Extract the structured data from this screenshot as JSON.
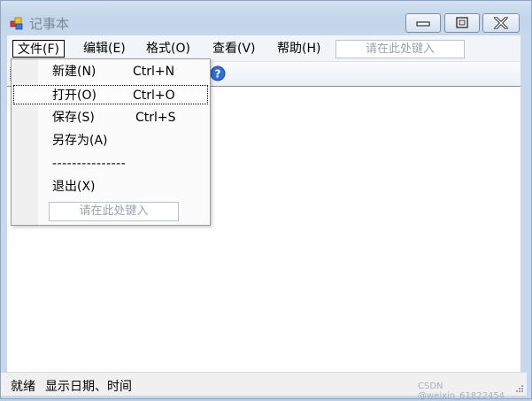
{
  "window": {
    "title": "记事本",
    "minimize_icon": "minimize-icon",
    "maximize_icon": "maximize-icon",
    "close_icon": "close-icon"
  },
  "menubar": {
    "items": [
      {
        "label": "文件(F)",
        "id": "file"
      },
      {
        "label": "编辑(E)",
        "id": "edit"
      },
      {
        "label": "格式(O)",
        "id": "format"
      },
      {
        "label": "查看(V)",
        "id": "view"
      },
      {
        "label": "帮助(H)",
        "id": "help"
      }
    ],
    "search_placeholder": "请在此处键入"
  },
  "toolbar": {
    "help_icon": "help-icon"
  },
  "file_menu": {
    "items": [
      {
        "label": "新建(N)",
        "shortcut": "Ctrl+N"
      },
      {
        "label": "打开(O)",
        "shortcut": "Ctrl+O"
      },
      {
        "label": "保存(S)",
        "shortcut": "Ctrl+S"
      },
      {
        "label": "另存为(A)",
        "shortcut": ""
      },
      {
        "label": "---------------",
        "shortcut": ""
      },
      {
        "label": "退出(X)",
        "shortcut": ""
      }
    ],
    "search_placeholder": "请在此处键入"
  },
  "statusbar": {
    "ready": "就绪",
    "datetime": "显示日期、时间"
  },
  "watermark": "CSDN @weixin_61822454",
  "colors": {
    "frame": "#c2d5ea",
    "menubar": "#f1f4f9",
    "help_icon": "#2e6fd8"
  }
}
